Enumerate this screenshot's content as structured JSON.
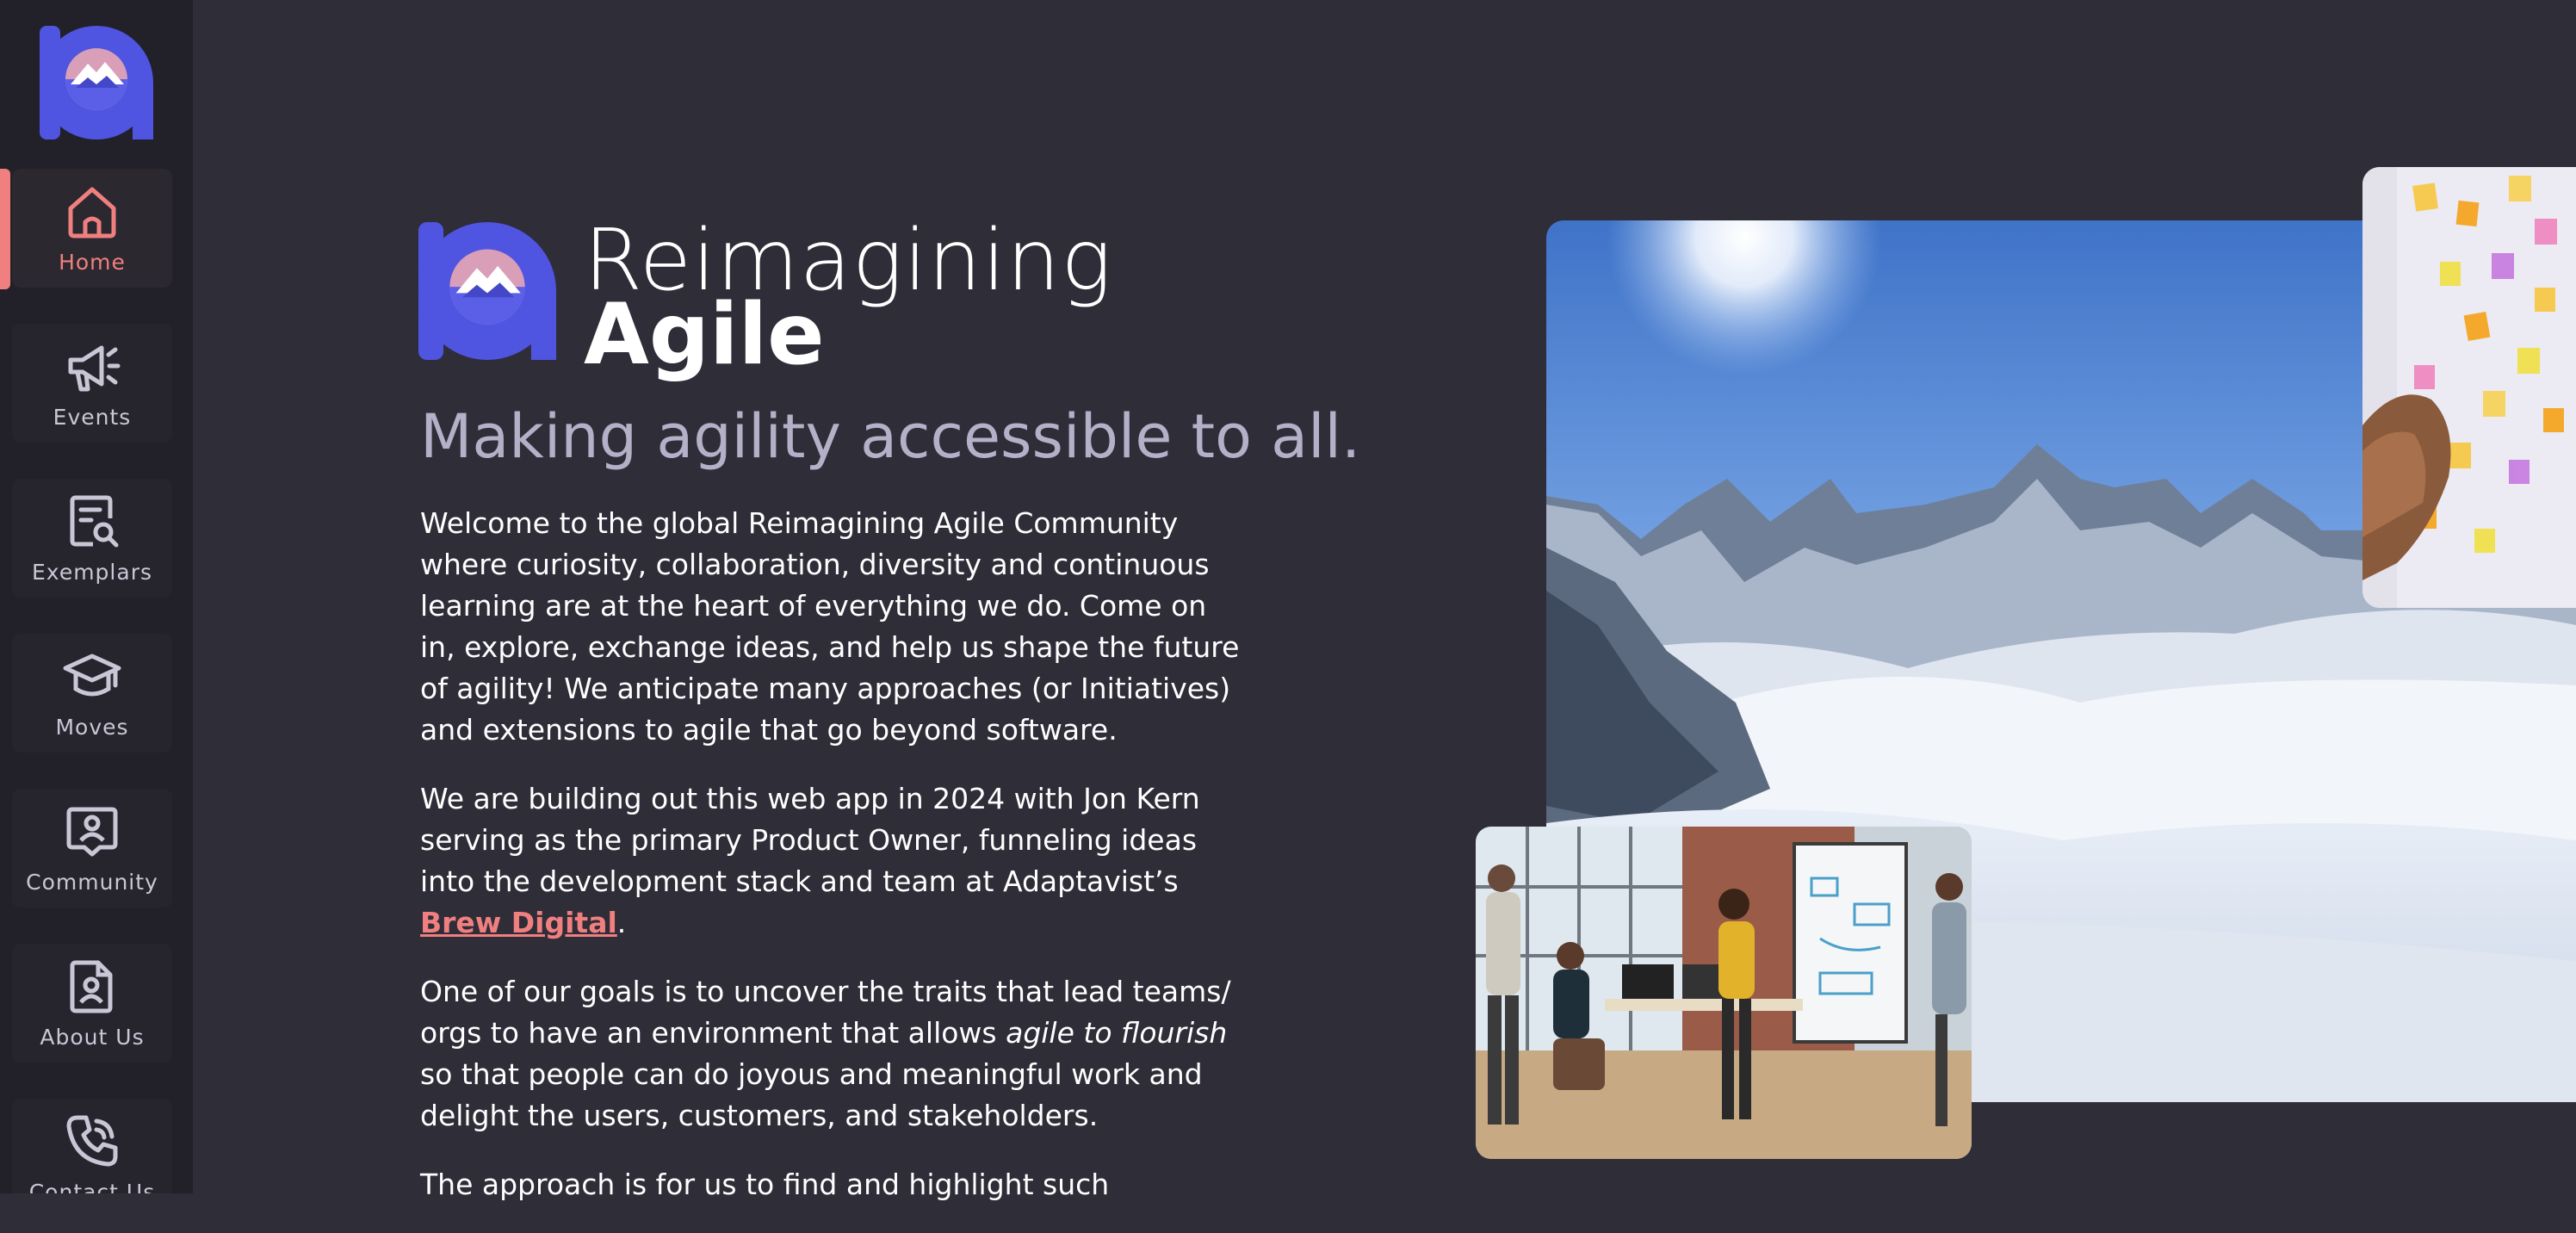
{
  "sidebar": {
    "items": [
      {
        "label": "Home",
        "icon": "home-icon",
        "active": true
      },
      {
        "label": "Events",
        "icon": "megaphone-icon"
      },
      {
        "label": "Exemplars",
        "icon": "document-search-icon"
      },
      {
        "label": "Moves",
        "icon": "graduation-cap-icon"
      },
      {
        "label": "Community",
        "icon": "user-speech-bubble-icon"
      },
      {
        "label": "About Us",
        "icon": "user-document-icon"
      },
      {
        "label": "Contact Us",
        "icon": "phone-icon"
      }
    ]
  },
  "brand": {
    "line1": "Reimagining",
    "line2": "Agile"
  },
  "hero": {
    "tagline": "Making agility accessible to all.",
    "para1": "Welcome to the global Reimagining Agile Community where curiosity, collaboration, diversity and continuous learning are at the heart of everything we do. Come on in, explore, exchange ideas, and help us shape the future of agility! We anticipate many approaches (or Initiatives) and extensions to agile that go beyond software.",
    "para2_text": "We are building out this web app in 2024 with Jon Kern serving as the primary Product Owner, funneling ideas into the development stack and team at Adaptavist’s ",
    "para2_link": "Brew Digital",
    "para2_end": ".",
    "para3_a": "One of our goals is to uncover the traits that lead teams/ orgs to have an environment that allows ",
    "para3_em": "agile to flourish",
    "para3_b": " so that people can do joyous and meaningful work and delight the users, customers, and stakeholders.",
    "para4": "The approach is for us to find and highlight such"
  },
  "colors": {
    "background": "#2f2d38",
    "sidebar": "#222129",
    "accent": "#f07f7f",
    "tagline": "#b3b0c8",
    "logo_blue": "#4f55e0"
  }
}
